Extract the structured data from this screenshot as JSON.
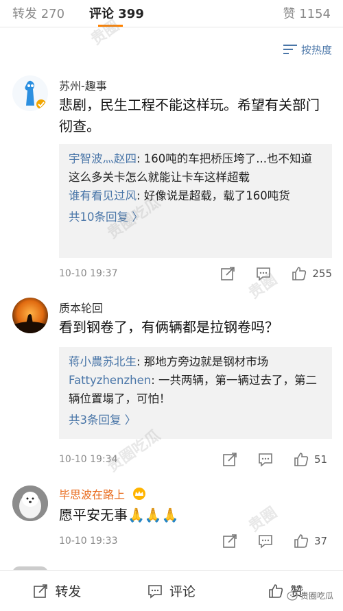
{
  "tabs": {
    "repost": "转发 270",
    "comment": "评论 399",
    "like": "赞 1154"
  },
  "sort": {
    "label": "按热度"
  },
  "comments": [
    {
      "user": "苏州-趣事",
      "text": "悲剧，民生工程不能这样玩。希望有关部门彻查。",
      "replies": [
        {
          "who": "宇智波灬赵四",
          "text": ": 160吨的车把桥压垮了...也不知道这么多关卡怎么就能让卡车这样超载"
        },
        {
          "who": "谁有看见过风",
          "text": ": 好像说是超载，载了160吨货"
        }
      ],
      "more": "共10条回复 〉",
      "time": "10-10 19:37",
      "likes": "255"
    },
    {
      "user": "质本轮回",
      "text": "看到钢卷了，有俩辆都是拉钢卷吗？",
      "replies": [
        {
          "who": "蒋小農苏北生",
          "text": ": 那地方旁边就是钢材市场"
        },
        {
          "who": "Fattyzhenzhen",
          "text": ": 一共两辆，第一辆过去了，第二辆位置塌了，可怕！"
        }
      ],
      "more": "共3条回复 〉",
      "time": "10-10 19:34",
      "likes": "51"
    },
    {
      "user": "毕思波在路上",
      "text": "愿平安无事🙏🙏🙏",
      "time": "10-10 19:33",
      "likes": "37"
    }
  ],
  "bottom": {
    "repost": "转发",
    "comment": "评论",
    "like": "赞"
  },
  "watermark": "贵圈吃瓜",
  "colors": {
    "accent": "#ff8200",
    "link": "#4a76a8",
    "vip": "#e86a1b"
  }
}
